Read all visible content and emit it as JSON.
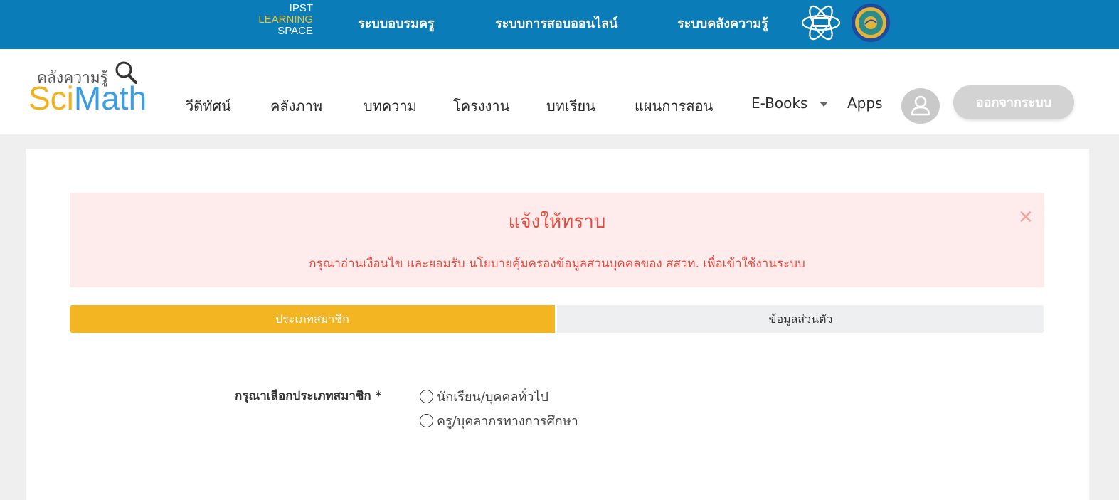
{
  "topbar": {
    "logo_line1": "IPST",
    "logo_line2": "LEARNING",
    "logo_line3": "SPACE",
    "links": [
      "ระบบอบรมครู",
      "ระบบการสอบออนไลน์",
      "ระบบคลังความรู้"
    ]
  },
  "brand": {
    "thai": "คลังความรู้",
    "sci": "Sci",
    "math": "Math"
  },
  "nav": {
    "items": [
      "วีดิทัศน์",
      "คลังภาพ",
      "บทความ",
      "โครงงาน",
      "บทเรียน",
      "แผนการสอน",
      "E-Books",
      "Apps"
    ],
    "logout_label": "ออกจากระบบ"
  },
  "alert": {
    "title": "แจ้งให้ทราบ",
    "message": "กรุณาอ่านเงื่อนไข และยอมรับ นโยบายคุ้มครองข้อมูลส่วนบุคคลของ สสวท. เพื่อเข้าใช้งานระบบ",
    "close_glyph": "✕"
  },
  "steps": [
    "ประเภทสมาชิก",
    "ข้อมูลส่วนตัว"
  ],
  "form": {
    "label": "กรุณาเลือกประเภทสมาชิก *",
    "options": [
      "นักเรียน/บุคคลทั่วไป",
      "ครู/บุคลากรทางการศึกษา"
    ]
  },
  "colors": {
    "topbar": "#0a7cb8",
    "accent_yellow": "#f3b521",
    "alert_text": "#e5493e",
    "alert_bg": "#fdeceb"
  },
  "icons": [
    "user-icon",
    "magnifier-icon",
    "close-icon",
    "caret-down-icon",
    "atom-emblem-icon",
    "seal-emblem-icon"
  ]
}
